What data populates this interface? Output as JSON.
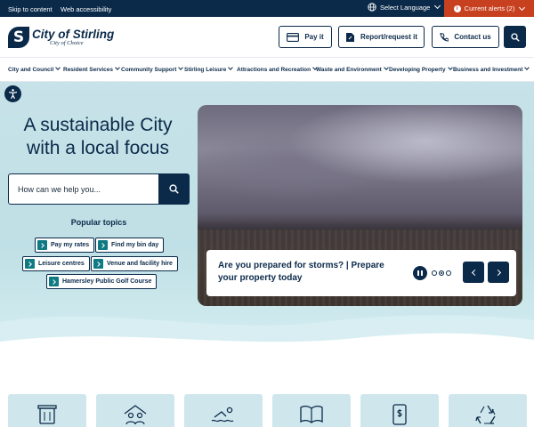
{
  "topbar": {
    "skip_link": "Skip to content",
    "accessibility_link": "Web accessibility",
    "language": "Select Language",
    "alerts": "Current alerts (2)",
    "alert_icon": "i"
  },
  "header": {
    "logo_initial": "S",
    "logo_name": "City of Stirling",
    "logo_tagline": "City of Choice",
    "buttons": {
      "pay": "Pay it",
      "report": "Report/request it",
      "contact": "Contact us"
    }
  },
  "nav": {
    "items": [
      "City and Council",
      "Resident Services",
      "Community Support",
      "Stirling Leisure",
      "Attractions and Recreation",
      "Waste and Environment",
      "Developing Property",
      "Business and Investment"
    ]
  },
  "hero": {
    "title_line1": "A sustainable City",
    "title_line2": "with a local focus",
    "search_placeholder": "How can we help you...",
    "popular_title": "Popular topics",
    "topics": [
      "Pay my rates",
      "Find my bin day",
      "Leisure centres",
      "Venue and facility hire",
      "Hamersley Public Golf Course"
    ],
    "slide_caption": "Are you prepared for storms? | Prepare your property today",
    "slide_count": 3,
    "active_slide": 2
  },
  "cards": {
    "icons": [
      "bin-icon",
      "people-home-icon",
      "swimmer-icon",
      "book-icon",
      "phone-payment-icon",
      "recycle-icon"
    ]
  },
  "colors": {
    "navy": "#0b2a4a",
    "alert": "#c7401f",
    "teal": "#0f7a84",
    "hero_bg": "#c7e2e8",
    "card_bg": "#cfe7ec"
  }
}
